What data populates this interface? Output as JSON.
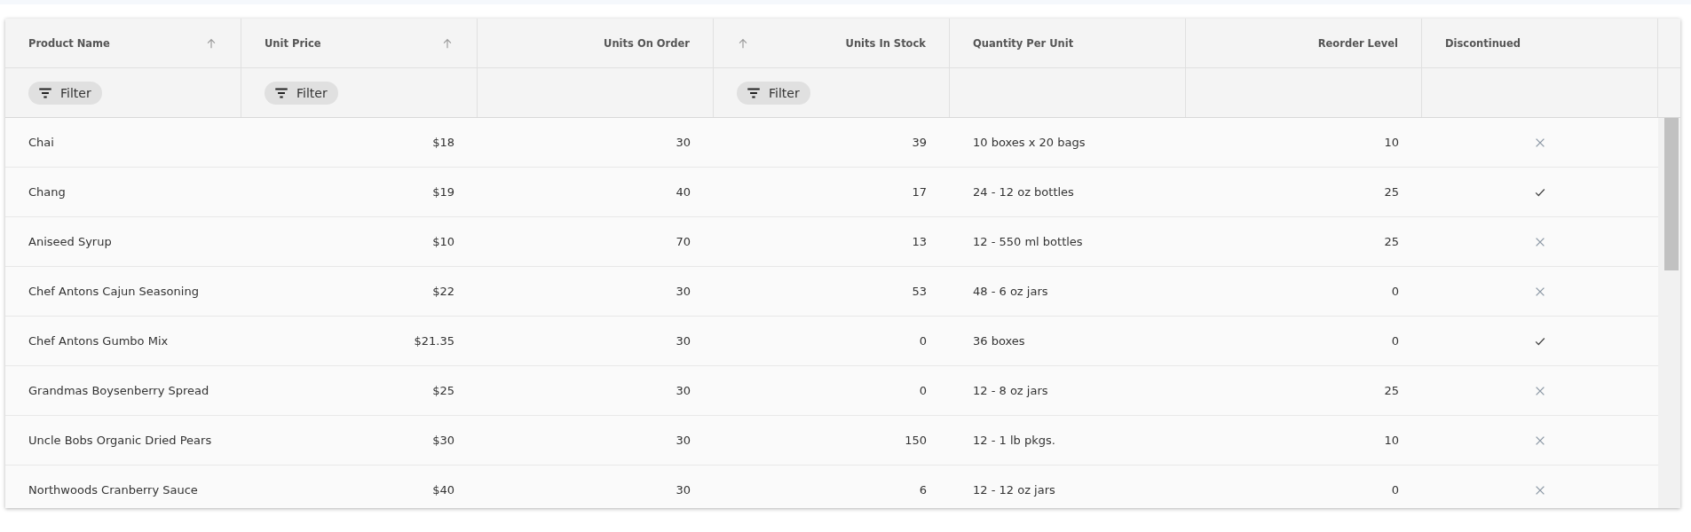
{
  "table": {
    "columns": [
      {
        "label": "Product Name",
        "kind": "text",
        "sort_icon": true,
        "filter": "Filter"
      },
      {
        "label": "Unit Price",
        "kind": "price",
        "sort_icon": true,
        "filter": "Filter"
      },
      {
        "label": "Units On Order",
        "kind": "number",
        "sort_icon": false
      },
      {
        "label": "Units In Stock",
        "kind": "number",
        "sort_icon": true,
        "filter": "Filter"
      },
      {
        "label": "Quantity Per Unit",
        "kind": "text",
        "sort_icon": false
      },
      {
        "label": "Reorder Level",
        "kind": "number",
        "sort_icon": false
      },
      {
        "label": "Discontinued",
        "kind": "boolean",
        "sort_icon": false
      }
    ],
    "rows": [
      {
        "cells": [
          "Chai",
          "$18",
          "30",
          "39",
          "10 boxes x 20 bags",
          "10"
        ],
        "discontinued": false
      },
      {
        "cells": [
          "Chang",
          "$19",
          "40",
          "17",
          "24 - 12 oz bottles",
          "25"
        ],
        "discontinued": true
      },
      {
        "cells": [
          "Aniseed Syrup",
          "$10",
          "70",
          "13",
          "12 - 550 ml bottles",
          "25"
        ],
        "discontinued": false
      },
      {
        "cells": [
          "Chef Antons Cajun Seasoning",
          "$22",
          "30",
          "53",
          "48 - 6 oz jars",
          "0"
        ],
        "discontinued": false
      },
      {
        "cells": [
          "Chef Antons Gumbo Mix",
          "$21.35",
          "30",
          "0",
          "36 boxes",
          "0"
        ],
        "discontinued": true
      },
      {
        "cells": [
          "Grandmas Boysenberry Spread",
          "$25",
          "30",
          "0",
          "12 - 8 oz jars",
          "25"
        ],
        "discontinued": false
      },
      {
        "cells": [
          "Uncle Bobs Organic Dried Pears",
          "$30",
          "30",
          "150",
          "12 - 1 lb pkgs.",
          "10"
        ],
        "discontinued": false
      },
      {
        "cells": [
          "Northwoods Cranberry Sauce",
          "$40",
          "30",
          "6",
          "12 - 12 oz jars",
          "0"
        ],
        "discontinued": false
      }
    ]
  }
}
